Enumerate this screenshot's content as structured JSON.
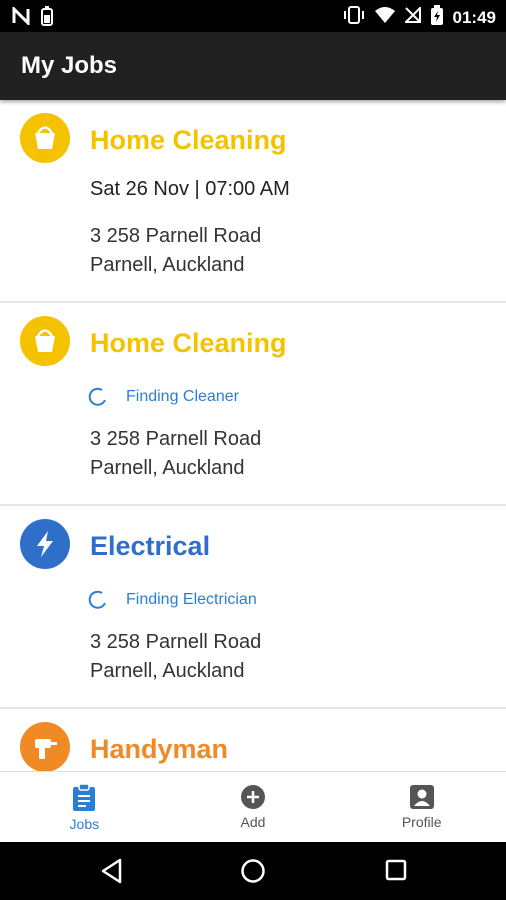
{
  "status_bar": {
    "time": "01:49",
    "icons": [
      "n-icon",
      "battery-saver-icon",
      "vibrate-icon",
      "wifi-icon",
      "no-signal-icon",
      "battery-icon"
    ]
  },
  "app_bar": {
    "title": "My Jobs"
  },
  "jobs": [
    {
      "service": "Home Cleaning",
      "icon": "bucket-icon",
      "color": "#f5c200",
      "datetime": "Sat 26 Nov | 07:00 AM",
      "address_line1": "3 258 Parnell Road",
      "address_line2": "Parnell, Auckland"
    },
    {
      "service": "Home Cleaning",
      "icon": "bucket-icon",
      "color": "#f5c200",
      "status": "Finding Cleaner",
      "address_line1": "3 258 Parnell Road",
      "address_line2": "Parnell, Auckland"
    },
    {
      "service": "Electrical",
      "icon": "lightning-icon",
      "color": "#2f6fc9",
      "status": "Finding Electrician",
      "address_line1": "3 258 Parnell Road",
      "address_line2": "Parnell, Auckland"
    },
    {
      "service": "Handyman",
      "icon": "drill-icon",
      "color": "#f08a24"
    }
  ],
  "bottom_nav": {
    "items": [
      {
        "label": "Jobs",
        "icon": "clipboard-icon",
        "active": true
      },
      {
        "label": "Add",
        "icon": "add-circle-icon",
        "active": false
      },
      {
        "label": "Profile",
        "icon": "profile-icon",
        "active": false
      }
    ],
    "active_color": "#2a7fd4",
    "inactive_color": "#555555"
  },
  "system_nav": {
    "icons": [
      "back-icon",
      "home-icon",
      "recents-icon"
    ]
  }
}
